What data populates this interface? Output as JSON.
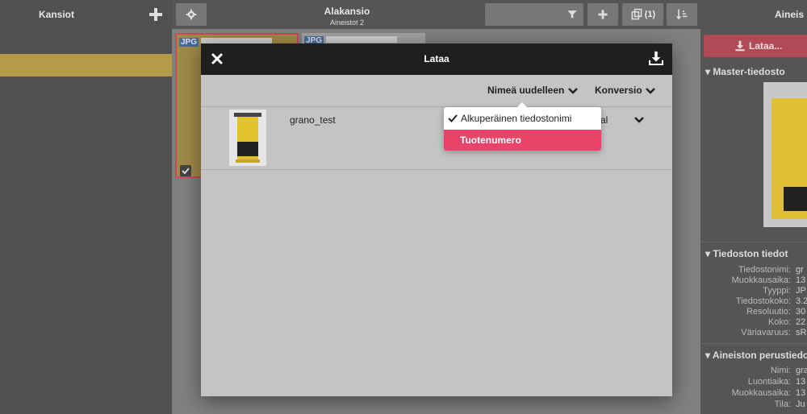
{
  "topbar": {
    "folders_title": "Kansiot",
    "subfolder_title": "Alakansio",
    "subfolder_subtitle": "Aineistot 2",
    "copy_count": "(1)",
    "right_title": "Aineis"
  },
  "grid": {
    "cards": [
      {
        "badge": "JPG",
        "selected": true
      },
      {
        "badge": "JPG",
        "selected": false
      }
    ]
  },
  "right_panel": {
    "load_button": "Lataa...",
    "master_section": "Master-tiedosto",
    "file_info_section": "Tiedoston tiedot",
    "file_info": [
      {
        "key": "Tiedostonimi:",
        "value": "gr"
      },
      {
        "key": "Muokkausaika:",
        "value": "13"
      },
      {
        "key": "Tyyppi:",
        "value": "JP"
      },
      {
        "key": "Tiedostokoko:",
        "value": "3.2"
      },
      {
        "key": "Resoluutio:",
        "value": "30"
      },
      {
        "key": "Koko:",
        "value": "22"
      },
      {
        "key": "Väriavaruus:",
        "value": "sR"
      }
    ],
    "basic_section": "Aineiston perustiedot",
    "basic_info": [
      {
        "key": "Nimi:",
        "value": "gra"
      },
      {
        "key": "Luontiaika:",
        "value": "13"
      },
      {
        "key": "Muokkausaika:",
        "value": "13"
      },
      {
        "key": "Tila:",
        "value": "Ju"
      }
    ]
  },
  "modal": {
    "title": "Lataa",
    "rename_label": "Nimeä uudelleen",
    "convert_label": "Konversio",
    "file_name": "grano_test",
    "row_conversion_partial": "al",
    "rename_options": [
      {
        "label": "Alkuperäinen tiedostonimi",
        "checked": true
      },
      {
        "label": "Tuotenumero",
        "highlighted": true
      }
    ]
  },
  "colors": {
    "accent": "#e9436a",
    "selection": "#b59a48",
    "badge": "#496b9a"
  }
}
